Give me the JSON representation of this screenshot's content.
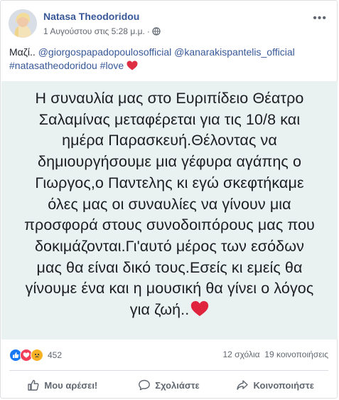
{
  "post": {
    "author": "Natasa Theodoridou",
    "timestamp": "1 Αυγούστου στις 5:28 μ.μ.",
    "separator": "·",
    "caption_prefix": "Μαζί.. ",
    "mention_1": "@giorgospapadopoulosofficial",
    "mention_2": "@kanarakispantelis_official",
    "hashtag_1": "#natasatheodoridou",
    "hashtag_2": "#love",
    "more_label": "•••",
    "banner_lines": [
      "Η συναυλία μας στο Ευριπίδειο Θέατρο",
      "Σαλαμίνας μεταφέρεται για τις 10/8 και",
      "ημέρα Παρασκευή.Θέλοντας να",
      "δημιουργήσουμε μια γέφυρα αγάπης ο",
      "Γιωργος,ο Παντελης κι εγώ σκεφτήκαμε",
      "όλες μας οι συναυλίες να γίνουν μια",
      "προσφορά στους συνοδοιπόρους μας που",
      "δοκιμάζονται.Γι'αυτό μέρος των εσόδων",
      "μας θα είναι δικό τους.Εσείς κι εμείς θα",
      "γίνουμε ένα και η μουσική θα γίνει ο λόγος",
      "για ζωή.."
    ],
    "banner_background": "#e9f2f1"
  },
  "stats": {
    "reactions_count": "452",
    "comments": "12 σχόλια",
    "shares": "19 κοινοποιήσεις"
  },
  "actions": {
    "like": "Μου αρέσει!",
    "comment": "Σχολιάστε",
    "share": "Κοινοποιήστε"
  },
  "colors": {
    "link": "#385898",
    "like_blue": "#1877f2",
    "love_red": "#f33e58",
    "sad_yellow": "#f7b125"
  }
}
